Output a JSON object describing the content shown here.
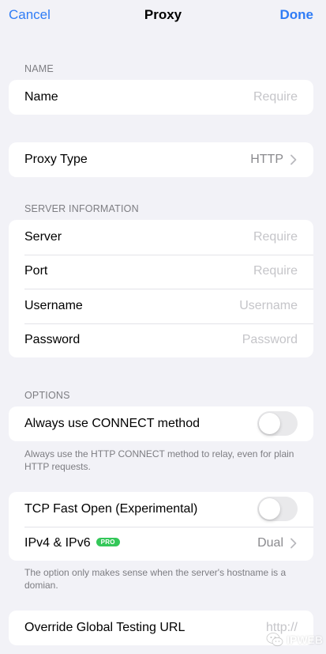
{
  "nav": {
    "cancel_label": "Cancel",
    "title": "Proxy",
    "done_label": "Done"
  },
  "sections": {
    "name_header": "NAME",
    "server_header": "SERVER INFORMATION",
    "options_header": "OPTIONS"
  },
  "name_group": {
    "name_label": "Name",
    "name_placeholder": "Require",
    "name_value": ""
  },
  "proxy_type": {
    "label": "Proxy Type",
    "value": "HTTP"
  },
  "server_group": {
    "server_label": "Server",
    "server_placeholder": "Require",
    "port_label": "Port",
    "port_placeholder": "Require",
    "username_label": "Username",
    "username_placeholder": "Username",
    "password_label": "Password",
    "password_placeholder": "Password"
  },
  "options": {
    "connect_label": "Always use CONNECT method",
    "connect_enabled": false,
    "connect_note": "Always use the HTTP CONNECT method to relay, even for plain HTTP requests.",
    "tfo_label": "TCP Fast Open (Experimental)",
    "tfo_enabled": false,
    "ip_label": "IPv4 & IPv6",
    "ip_badge": "PRO",
    "ip_value": "Dual",
    "ip_note": "The option only makes sense when the server's hostname is a domian.",
    "override_label": "Override Global Testing URL",
    "override_placeholder": "http://"
  },
  "watermark": {
    "text": "IPWEB"
  },
  "colors": {
    "accent": "#2f7cf6",
    "background": "#f2f2f7",
    "badge": "#34c759"
  }
}
